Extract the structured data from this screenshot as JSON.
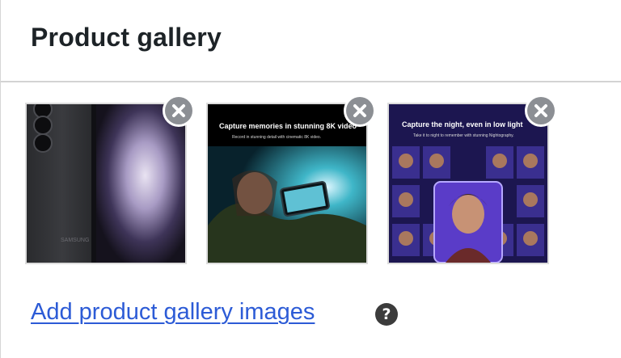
{
  "panel": {
    "title": "Product gallery"
  },
  "gallery": {
    "images": [
      {
        "overlay_title": "",
        "remove_label": "Remove image",
        "device_brand": "SAMSUNG"
      },
      {
        "overlay_title": "Capture memories in stunning 8K video",
        "remove_label": "Remove image",
        "overlay_sub": "Record in stunning detail with cinematic 8K video."
      },
      {
        "overlay_title": "Capture the night, even in low light",
        "remove_label": "Remove image",
        "overlay_sub": "Take it to night to remember with stunning Nightography."
      }
    ]
  },
  "footer": {
    "add_link": "Add product gallery images",
    "help_glyph": "?"
  },
  "colors": {
    "link": "#2c5bd6",
    "remove_badge": "#8c8f94",
    "title_text": "#1d2327"
  },
  "icons": [
    "remove-icon",
    "help-icon"
  ]
}
